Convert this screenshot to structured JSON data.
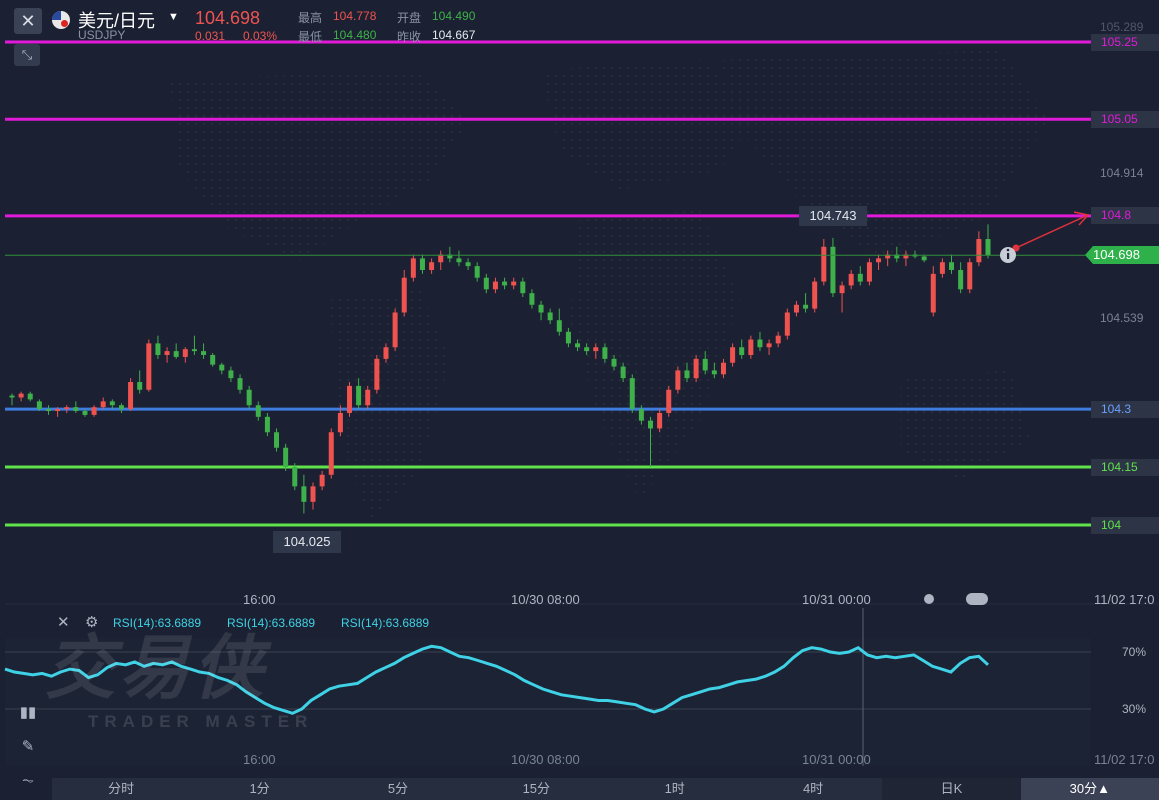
{
  "header": {
    "close_label": "✕",
    "pair_name": "美元/日元",
    "pair_code": "USDJPY",
    "last_price": "104.698",
    "change": "0.031",
    "change_pct": "0.03%",
    "high_label": "最高",
    "high_value": "104.778",
    "open_label": "开盘",
    "open_value": "104.490",
    "low_label": "最低",
    "low_value": "104.480",
    "prev_close_label": "昨收",
    "prev_close_value": "104.667"
  },
  "colors": {
    "background": "#1b2132",
    "up": "#ef5350",
    "down": "#3fb14a",
    "magenta": "#e11ad9",
    "blue": "#3e7de0",
    "green": "#5fe24a",
    "rsi": "#3fd2e6"
  },
  "price_axis": {
    "ticks": [
      "105.289",
      "104.914",
      "104.539"
    ],
    "current": "104.698"
  },
  "levels": [
    {
      "label": "105.25",
      "value": 105.25,
      "color": "#e11ad9"
    },
    {
      "label": "105.05",
      "value": 105.05,
      "color": "#e11ad9"
    },
    {
      "label": "104.8",
      "value": 104.8,
      "color": "#e11ad9"
    },
    {
      "label": "104.3",
      "value": 104.3,
      "color": "#3e7de0"
    },
    {
      "label": "104.15",
      "value": 104.15,
      "color": "#5fe24a"
    },
    {
      "label": "104",
      "value": 104.0,
      "color": "#5fe24a"
    }
  ],
  "annotations": {
    "max_label": "104.743",
    "min_label": "104.025"
  },
  "time_axis": [
    "16:00",
    "10/30 08:00",
    "10/31 00:00",
    "11/02 17:0"
  ],
  "rsi": {
    "legend": [
      "RSI(14):63.6889",
      "RSI(14):63.6889",
      "RSI(14):63.6889"
    ],
    "levels": [
      "70%",
      "30%"
    ]
  },
  "watermark": {
    "title": "交易侠",
    "subtitle": "TRADER MASTER"
  },
  "footer_tabs": [
    "分时",
    "1分",
    "5分",
    "15分",
    "1时",
    "4时",
    "日K",
    "30分▲"
  ],
  "chart_data": {
    "type": "candlestick",
    "ylim": [
      104.0,
      105.25
    ],
    "candles": [
      [
        104.335,
        104.34,
        104.31,
        104.33
      ],
      [
        104.33,
        104.345,
        104.32,
        104.34
      ],
      [
        104.34,
        104.345,
        104.32,
        104.325
      ],
      [
        104.32,
        104.325,
        104.295,
        104.3
      ],
      [
        104.3,
        104.31,
        104.285,
        104.295
      ],
      [
        104.295,
        104.305,
        104.28,
        104.3
      ],
      [
        104.3,
        104.31,
        104.29,
        104.305
      ],
      [
        104.305,
        104.32,
        104.29,
        104.295
      ],
      [
        104.295,
        104.3,
        104.28,
        104.285
      ],
      [
        104.285,
        104.31,
        104.28,
        104.305
      ],
      [
        104.305,
        104.33,
        104.3,
        104.32
      ],
      [
        104.32,
        104.325,
        104.3,
        104.31
      ],
      [
        104.31,
        104.315,
        104.29,
        104.3
      ],
      [
        104.3,
        104.38,
        104.295,
        104.37
      ],
      [
        104.37,
        104.4,
        104.34,
        104.35
      ],
      [
        104.35,
        104.48,
        104.345,
        104.47
      ],
      [
        104.47,
        104.49,
        104.43,
        104.44
      ],
      [
        104.44,
        104.46,
        104.42,
        104.45
      ],
      [
        104.45,
        104.47,
        104.43,
        104.435
      ],
      [
        104.435,
        104.46,
        104.42,
        104.455
      ],
      [
        104.455,
        104.49,
        104.44,
        104.45
      ],
      [
        104.45,
        104.47,
        104.43,
        104.44
      ],
      [
        104.44,
        104.445,
        104.41,
        104.415
      ],
      [
        104.415,
        104.42,
        104.39,
        104.4
      ],
      [
        104.4,
        104.41,
        104.37,
        104.38
      ],
      [
        104.38,
        104.39,
        104.34,
        104.35
      ],
      [
        104.35,
        104.36,
        104.3,
        104.31
      ],
      [
        104.31,
        104.32,
        104.27,
        104.28
      ],
      [
        104.28,
        104.29,
        104.23,
        104.24
      ],
      [
        104.24,
        104.25,
        104.19,
        104.2
      ],
      [
        104.2,
        104.21,
        104.14,
        104.15
      ],
      [
        104.15,
        104.16,
        104.09,
        104.1
      ],
      [
        104.1,
        104.13,
        104.03,
        104.06
      ],
      [
        104.06,
        104.11,
        104.04,
        104.1
      ],
      [
        104.1,
        104.14,
        104.09,
        104.13
      ],
      [
        104.13,
        104.25,
        104.12,
        104.24
      ],
      [
        104.24,
        104.31,
        104.23,
        104.29
      ],
      [
        104.29,
        104.37,
        104.28,
        104.36
      ],
      [
        104.36,
        104.38,
        104.3,
        104.31
      ],
      [
        104.31,
        104.36,
        104.3,
        104.35
      ],
      [
        104.35,
        104.44,
        104.34,
        104.43
      ],
      [
        104.43,
        104.47,
        104.42,
        104.46
      ],
      [
        104.46,
        104.56,
        104.45,
        104.55
      ],
      [
        104.55,
        104.66,
        104.54,
        104.64
      ],
      [
        104.64,
        104.7,
        104.63,
        104.69
      ],
      [
        104.69,
        104.7,
        104.65,
        104.66
      ],
      [
        104.66,
        104.69,
        104.65,
        104.68
      ],
      [
        104.68,
        104.71,
        104.66,
        104.7
      ],
      [
        104.7,
        104.72,
        104.68,
        104.69
      ],
      [
        104.69,
        104.71,
        104.67,
        104.68
      ],
      [
        104.68,
        104.69,
        104.66,
        104.67
      ],
      [
        104.67,
        104.68,
        104.63,
        104.64
      ],
      [
        104.64,
        104.65,
        104.6,
        104.61
      ],
      [
        104.61,
        104.64,
        104.6,
        104.63
      ],
      [
        104.63,
        104.64,
        104.61,
        104.62
      ],
      [
        104.62,
        104.64,
        104.61,
        104.63
      ],
      [
        104.63,
        104.64,
        104.59,
        104.6
      ],
      [
        104.6,
        104.61,
        104.56,
        104.57
      ],
      [
        104.57,
        104.58,
        104.53,
        104.55
      ],
      [
        104.55,
        104.56,
        104.52,
        104.53
      ],
      [
        104.53,
        104.56,
        104.49,
        104.5
      ],
      [
        104.5,
        104.51,
        104.46,
        104.47
      ],
      [
        104.47,
        104.48,
        104.45,
        104.46
      ],
      [
        104.46,
        104.47,
        104.44,
        104.45
      ],
      [
        104.45,
        104.47,
        104.43,
        104.46
      ],
      [
        104.46,
        104.47,
        104.42,
        104.43
      ],
      [
        104.43,
        104.44,
        104.4,
        104.41
      ],
      [
        104.41,
        104.42,
        104.37,
        104.38
      ],
      [
        104.38,
        104.39,
        104.29,
        104.3
      ],
      [
        104.3,
        104.31,
        104.26,
        104.27
      ],
      [
        104.27,
        104.28,
        104.15,
        104.25
      ],
      [
        104.25,
        104.3,
        104.24,
        104.29
      ],
      [
        104.29,
        104.36,
        104.28,
        104.35
      ],
      [
        104.35,
        104.41,
        104.34,
        104.4
      ],
      [
        104.4,
        104.42,
        104.37,
        104.38
      ],
      [
        104.38,
        104.44,
        104.37,
        104.43
      ],
      [
        104.43,
        104.45,
        104.39,
        104.4
      ],
      [
        104.4,
        104.42,
        104.38,
        104.39
      ],
      [
        104.39,
        104.43,
        104.38,
        104.42
      ],
      [
        104.42,
        104.47,
        104.41,
        104.46
      ],
      [
        104.46,
        104.48,
        104.43,
        104.44
      ],
      [
        104.44,
        104.49,
        104.43,
        104.48
      ],
      [
        104.48,
        104.5,
        104.45,
        104.46
      ],
      [
        104.46,
        104.48,
        104.44,
        104.47
      ],
      [
        104.47,
        104.5,
        104.46,
        104.49
      ],
      [
        104.49,
        104.56,
        104.48,
        104.55
      ],
      [
        104.55,
        104.58,
        104.54,
        104.57
      ],
      [
        104.57,
        104.6,
        104.55,
        104.56
      ],
      [
        104.56,
        104.64,
        104.55,
        104.63
      ],
      [
        104.63,
        104.74,
        104.62,
        104.72
      ],
      [
        104.72,
        104.743,
        104.59,
        104.6
      ],
      [
        104.6,
        104.63,
        104.55,
        104.62
      ],
      [
        104.62,
        104.66,
        104.61,
        104.65
      ],
      [
        104.65,
        104.67,
        104.62,
        104.63
      ],
      [
        104.63,
        104.69,
        104.62,
        104.68
      ],
      [
        104.68,
        104.7,
        104.66,
        104.69
      ],
      [
        104.69,
        104.71,
        104.67,
        104.7
      ],
      [
        104.7,
        104.72,
        104.68,
        104.69
      ],
      [
        104.69,
        104.71,
        104.67,
        104.7
      ],
      [
        104.7,
        104.71,
        104.69,
        104.695
      ],
      [
        104.695,
        104.7,
        104.68,
        104.685
      ],
      [
        104.55,
        104.67,
        104.54,
        104.65
      ],
      [
        104.65,
        104.69,
        104.64,
        104.68
      ],
      [
        104.68,
        104.7,
        104.65,
        104.66
      ],
      [
        104.66,
        104.68,
        104.6,
        104.61
      ],
      [
        104.61,
        104.69,
        104.6,
        104.68
      ],
      [
        104.68,
        104.76,
        104.67,
        104.74
      ],
      [
        104.74,
        104.778,
        104.69,
        104.698
      ]
    ],
    "rsi_values": [
      58,
      56,
      55,
      54,
      55,
      53,
      56,
      58,
      57,
      52,
      54,
      59,
      62,
      61,
      63,
      60,
      62,
      61,
      63,
      60,
      58,
      56,
      55,
      52,
      50,
      47,
      42,
      38,
      34,
      31,
      29,
      27,
      30,
      36,
      40,
      44,
      46,
      47,
      48,
      52,
      56,
      59,
      62,
      66,
      69,
      72,
      74,
      73,
      70,
      67,
      66,
      64,
      62,
      60,
      57,
      54,
      50,
      47,
      44,
      42,
      40,
      39,
      38,
      37,
      36,
      36,
      35,
      34,
      33,
      30,
      28,
      30,
      34,
      38,
      40,
      42,
      44,
      45,
      47,
      49,
      50,
      51,
      53,
      56,
      60,
      66,
      71,
      73,
      72,
      70,
      69,
      70,
      73,
      68,
      66,
      67,
      66,
      67,
      68,
      64,
      60,
      58,
      56,
      62,
      66,
      67,
      61
    ],
    "levels": {
      "105.25": "magenta",
      "105.05": "magenta",
      "104.8": "magenta",
      "104.3": "blue",
      "104.15": "green",
      "104": "green"
    }
  }
}
